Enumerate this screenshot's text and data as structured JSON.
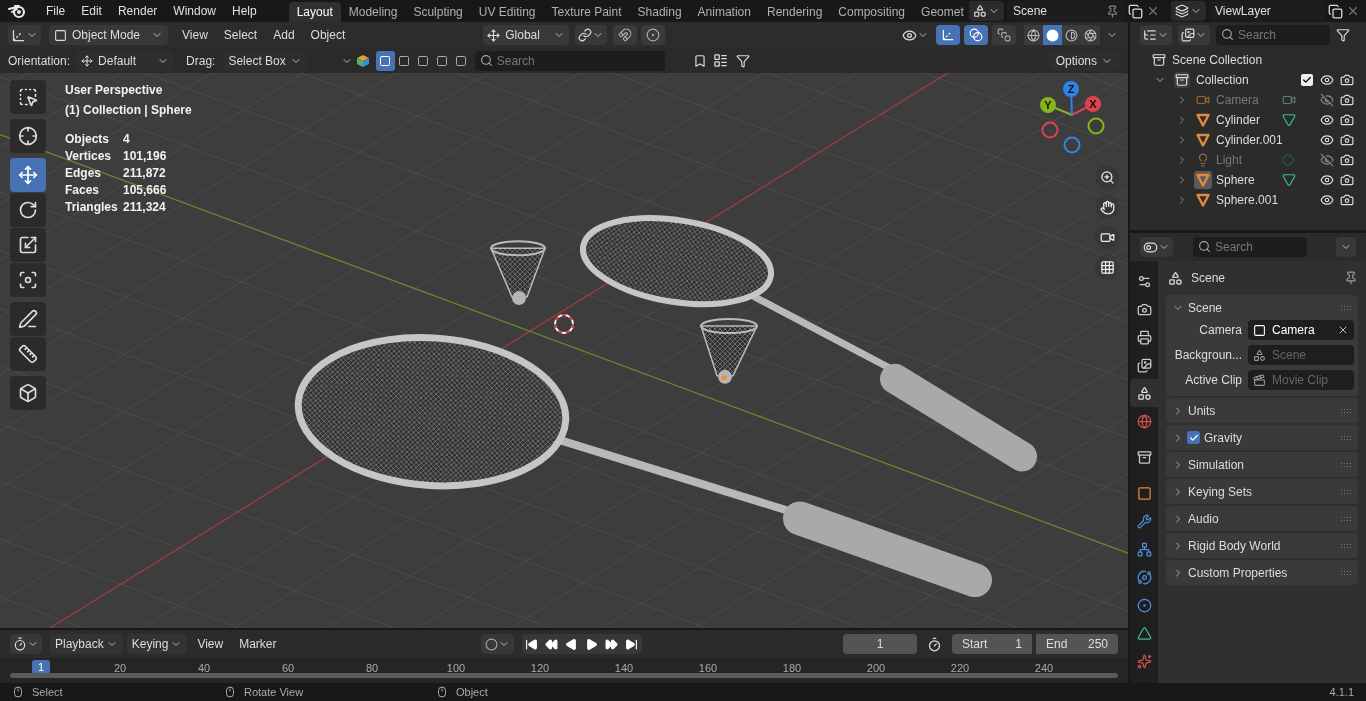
{
  "top_menu": [
    "File",
    "Edit",
    "Render",
    "Window",
    "Help"
  ],
  "workspace_tabs": [
    {
      "label": "Layout",
      "selected": true
    },
    {
      "label": "Modeling",
      "selected": false
    },
    {
      "label": "Sculpting",
      "selected": false
    },
    {
      "label": "UV Editing",
      "selected": false
    },
    {
      "label": "Texture Paint",
      "selected": false
    },
    {
      "label": "Shading",
      "selected": false
    },
    {
      "label": "Animation",
      "selected": false
    },
    {
      "label": "Rendering",
      "selected": false
    },
    {
      "label": "Compositing",
      "selected": false
    },
    {
      "label": "Geomet",
      "selected": false
    }
  ],
  "scene": {
    "name": "Scene"
  },
  "view_layer": {
    "name": "ViewLayer"
  },
  "viewport": {
    "mode": "Object Mode",
    "menus": [
      "View",
      "Select",
      "Add",
      "Object"
    ],
    "orientation": "Global",
    "snapping_toggles": [
      {
        "kind": "snap",
        "on": false
      },
      {
        "kind": "proportional",
        "on": false
      }
    ],
    "view_toggles": [
      {
        "kind": "gizmo",
        "on": true
      },
      {
        "kind": "overlay",
        "on": true
      },
      {
        "kind": "xray",
        "on": false
      }
    ],
    "shading_modes": [
      {
        "kind": "wireframe",
        "selected": false
      },
      {
        "kind": "solid",
        "selected": true
      },
      {
        "kind": "material",
        "selected": false
      },
      {
        "kind": "rendered",
        "selected": false
      }
    ],
    "tool_settings": {
      "orientation_label": "Orientation:",
      "orientation": "Default",
      "drag_label": "Drag:",
      "drag": "Select Box",
      "search_placeholder": "Search",
      "options": "Options"
    },
    "select_modes": [
      {
        "selected": true
      },
      {
        "selected": false
      },
      {
        "selected": false
      },
      {
        "selected": false
      },
      {
        "selected": false
      }
    ],
    "view_name": "User Perspective",
    "active": "(1) Collection | Sphere",
    "stats": [
      {
        "label": "Objects",
        "value": "4"
      },
      {
        "label": "Vertices",
        "value": "101,196"
      },
      {
        "label": "Edges",
        "value": "211,872"
      },
      {
        "label": "Faces",
        "value": "105,666"
      },
      {
        "label": "Triangles",
        "value": "211,324"
      }
    ],
    "tool_groups": [
      [
        {
          "kind": "select_box",
          "selected": false
        }
      ],
      [
        {
          "kind": "cursor",
          "selected": false
        }
      ],
      [
        {
          "kind": "move",
          "selected": true
        },
        {
          "kind": "rotate",
          "selected": false
        },
        {
          "kind": "scale",
          "selected": false
        },
        {
          "kind": "transform",
          "selected": false
        }
      ],
      [
        {
          "kind": "annotate",
          "selected": false
        },
        {
          "kind": "measure",
          "selected": false
        }
      ],
      [
        {
          "kind": "add_cube",
          "selected": false
        }
      ]
    ],
    "gizmo_axes": [
      {
        "label": "X",
        "color": "#e0414f"
      },
      {
        "label": "Y",
        "color": "#84b51e"
      },
      {
        "label": "Z",
        "color": "#2f83e4"
      }
    ]
  },
  "outliner": {
    "search_placeholder": "Search",
    "root": "Scene Collection",
    "items": [
      {
        "name": "Collection",
        "kind": "collection",
        "expanded": true,
        "checked": true,
        "visible": true,
        "selected": false,
        "data_icon": false,
        "children": [
          {
            "name": "Camera",
            "kind": "camera",
            "visible": false,
            "selected": false,
            "data_icon": true
          },
          {
            "name": "Cylinder",
            "kind": "mesh",
            "visible": true,
            "selected": false,
            "data_icon": true
          },
          {
            "name": "Cylinder.001",
            "kind": "mesh",
            "visible": true,
            "selected": false,
            "data_icon": false
          },
          {
            "name": "Light",
            "kind": "light",
            "visible": false,
            "selected": false,
            "data_icon": true
          },
          {
            "name": "Sphere",
            "kind": "mesh",
            "visible": true,
            "selected": true,
            "data_icon": true
          },
          {
            "name": "Sphere.001",
            "kind": "mesh",
            "visible": true,
            "selected": false,
            "data_icon": false
          }
        ]
      }
    ]
  },
  "properties": {
    "search_placeholder": "Search",
    "tab_groups": [
      [
        {
          "kind": "tool",
          "selected": false
        },
        {
          "kind": "render",
          "selected": false
        },
        {
          "kind": "output",
          "selected": false
        },
        {
          "kind": "view_layer",
          "selected": false
        },
        {
          "kind": "scene",
          "selected": true
        },
        {
          "kind": "world",
          "selected": false
        }
      ],
      [
        {
          "kind": "collection",
          "selected": false
        }
      ],
      [
        {
          "kind": "object",
          "selected": false
        },
        {
          "kind": "modifiers",
          "selected": false
        },
        {
          "kind": "particles",
          "selected": false
        },
        {
          "kind": "physics",
          "selected": false
        },
        {
          "kind": "constraints",
          "selected": false
        },
        {
          "kind": "data",
          "selected": false
        },
        {
          "kind": "material",
          "selected": false
        }
      ]
    ],
    "context": "Scene",
    "panels": [
      {
        "title": "Scene",
        "expanded": true,
        "fields": [
          {
            "kind": "object",
            "label": "Camera",
            "value": "Camera"
          },
          {
            "kind": "scene",
            "label": "Backgroun...",
            "placeholder": "Scene"
          },
          {
            "kind": "clip",
            "label": "Active Clip",
            "placeholder": "Movie Clip"
          }
        ]
      },
      {
        "title": "Units",
        "expanded": false
      },
      {
        "title": "Gravity",
        "expanded": false,
        "checked": true
      },
      {
        "title": "Simulation",
        "expanded": false
      },
      {
        "title": "Keying Sets",
        "expanded": false
      },
      {
        "title": "Audio",
        "expanded": false
      },
      {
        "title": "Rigid Body World",
        "expanded": false
      },
      {
        "title": "Custom Properties",
        "expanded": false
      }
    ]
  },
  "timeline": {
    "menus": [
      {
        "label": "Playback",
        "dropdown": true
      },
      {
        "label": "Keying",
        "dropdown": true
      },
      {
        "label": "View",
        "dropdown": false
      },
      {
        "label": "Marker",
        "dropdown": false
      }
    ],
    "current_frame": "1",
    "start_label": "Start",
    "start": "1",
    "end_label": "End",
    "end": "250",
    "playhead": "1",
    "ticks": [
      "20",
      "40",
      "60",
      "80",
      "100",
      "120",
      "140",
      "160",
      "180",
      "200",
      "220",
      "240"
    ]
  },
  "status_bar": {
    "hints": [
      "Select",
      "Rotate View",
      "Object"
    ],
    "version": "4.1.1"
  }
}
